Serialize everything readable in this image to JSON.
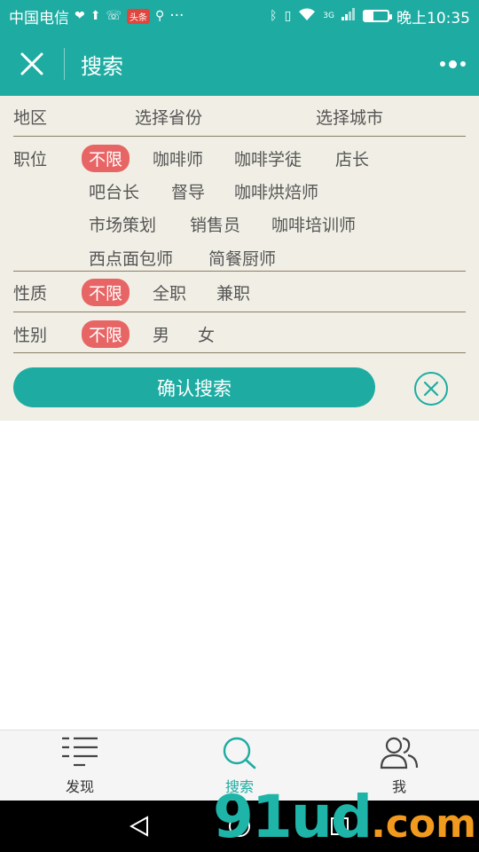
{
  "status_bar": {
    "carrier": "中国电信",
    "badge": "头条",
    "time": "晚上10:35",
    "signal_label": "3G",
    "dots": "···"
  },
  "header": {
    "title": "搜索",
    "close_icon": "close-icon",
    "more_icon": "more-icon"
  },
  "filters": {
    "region": {
      "label": "地区",
      "province": "选择省份",
      "city": "选择城市"
    },
    "position": {
      "label": "职位",
      "options": [
        "不限",
        "咖啡师",
        "咖啡学徒",
        "店长",
        "吧台长",
        "督导",
        "咖啡烘焙师",
        "市场策划",
        "销售员",
        "咖啡培训师",
        "西点面包师",
        "简餐厨师"
      ],
      "selected": "不限"
    },
    "nature": {
      "label": "性质",
      "options": [
        "不限",
        "全职",
        "兼职"
      ],
      "selected": "不限"
    },
    "gender": {
      "label": "性别",
      "options": [
        "不限",
        "男",
        "女"
      ],
      "selected": "不限"
    }
  },
  "actions": {
    "confirm_label": "确认搜索"
  },
  "tabs": [
    {
      "label": "发现",
      "icon": "list-icon",
      "active": false
    },
    {
      "label": "搜索",
      "icon": "search-icon",
      "active": true
    },
    {
      "label": "我",
      "icon": "users-icon",
      "active": false
    }
  ],
  "watermark": {
    "main": "91ud",
    "suffix": ".com"
  },
  "colors": {
    "accent": "#1eaca2",
    "selected_tag": "#e86565",
    "panel_bg": "#f1efe5"
  }
}
